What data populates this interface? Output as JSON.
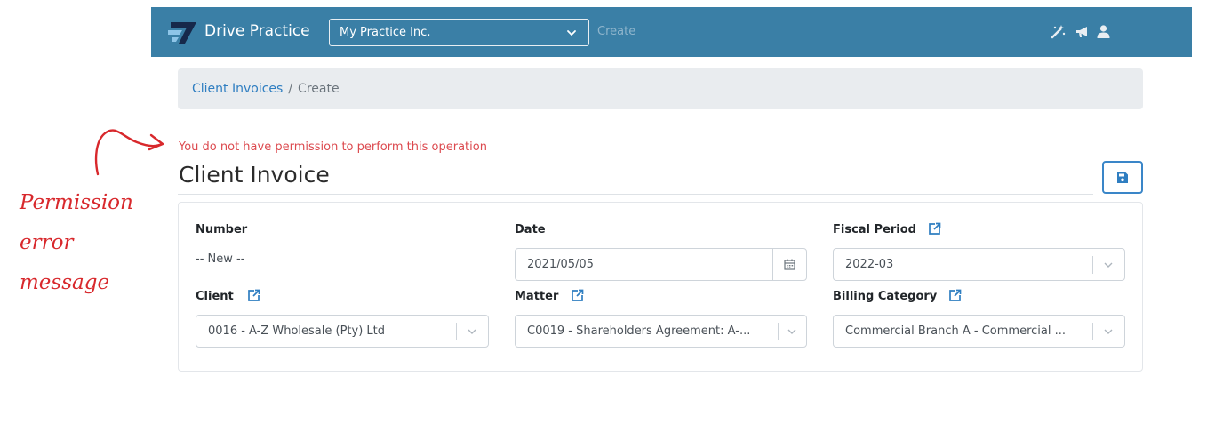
{
  "navbar": {
    "brand": "Drive Practice",
    "practice_select": "My Practice Inc.",
    "current_action": "Create",
    "icons": [
      "magic-wand-icon",
      "megaphone-icon",
      "user-icon"
    ]
  },
  "breadcrumb": {
    "link": "Client Invoices",
    "separator": "/",
    "current": "Create"
  },
  "error_message": "You do not have permission to perform this operation",
  "page_title": "Client Invoice",
  "annotation": {
    "lines": [
      "Permission",
      "error",
      "message"
    ],
    "color": "#d8282c"
  },
  "form": {
    "number": {
      "label": "Number",
      "value": "-- New --"
    },
    "date": {
      "label": "Date",
      "value": "2021/05/05"
    },
    "fiscal_period": {
      "label": "Fiscal Period",
      "value": "2022-03"
    },
    "client": {
      "label": "Client",
      "value": "0016 - A-Z Wholesale (Pty) Ltd"
    },
    "matter": {
      "label": "Matter",
      "value": "C0019 - Shareholders Agreement: A-..."
    },
    "billing_category": {
      "label": "Billing Category",
      "value": "Commercial Branch A - Commercial ..."
    }
  },
  "colors": {
    "navbar": "#3a7fa6",
    "link": "#2f7ec1",
    "error": "#dc4a4f",
    "save_button": "#3a86c8"
  }
}
